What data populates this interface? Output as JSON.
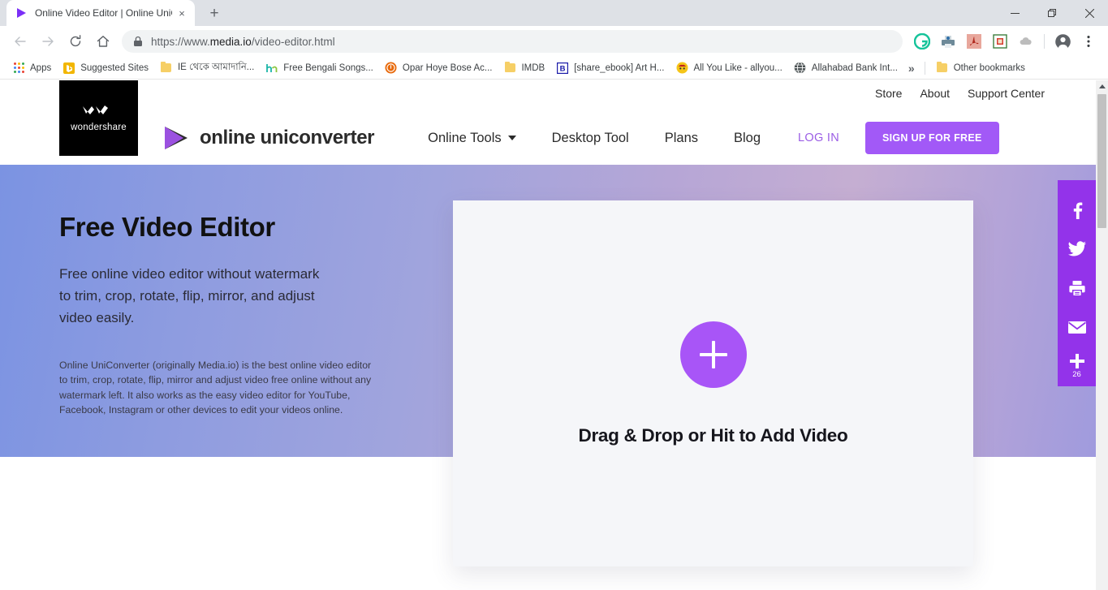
{
  "browser": {
    "tab": {
      "title": "Online Video Editor | Online UniC",
      "favicon_name": "play-triangle-favicon",
      "close_label": "×"
    },
    "new_tab_label": "+",
    "window_controls": {
      "minimize": "—",
      "maximize": "❐",
      "close": "✕"
    },
    "nav": {
      "back": "←",
      "forward": "→",
      "reload": "⟳",
      "home": "⌂"
    },
    "omnibox": {
      "scheme": "https://www.",
      "host": "media.io",
      "path": "/video-editor.html",
      "full_url": "https://www.media.io/video-editor.html",
      "lock_icon": "lock-icon"
    },
    "extensions": [
      {
        "name": "grammarly-extension-icon",
        "color": "#15c39a",
        "glyph": "G"
      },
      {
        "name": "printer-extension-icon",
        "color": "#8aa0ab",
        "glyph": ""
      },
      {
        "name": "adobe-acrobat-extension-icon",
        "color": "#d98c80",
        "glyph": ""
      },
      {
        "name": "red-box-extension-icon",
        "color": "#d64b3f",
        "glyph": ""
      },
      {
        "name": "cloud-extension-icon",
        "color": "#bcbcbc",
        "glyph": ""
      }
    ],
    "profile_icon": "account-avatar-icon",
    "menu_icon": "three-dot-menu-icon",
    "bookmarks": [
      {
        "label": "Apps",
        "icon": "apps-grid-icon"
      },
      {
        "label": "Suggested Sites",
        "icon": "bing-icon"
      },
      {
        "label": "IE থেকে আমাদানি...",
        "icon": "folder-icon"
      },
      {
        "label": "Free Bengali Songs...",
        "icon": "hungama-icon"
      },
      {
        "label": "Opar Hoye Bose Ac...",
        "icon": "orange-circle-icon"
      },
      {
        "label": "IMDB",
        "icon": "folder-icon"
      },
      {
        "label": "[share_ebook] Art H...",
        "icon": "b-letter-icon"
      },
      {
        "label": "All You Like - allyou...",
        "icon": "yellow-face-icon"
      },
      {
        "label": "Allahabad Bank  Int...",
        "icon": "globe-icon"
      }
    ],
    "bookmarks_overflow": "»",
    "other_bookmarks": {
      "label": "Other bookmarks",
      "icon": "folder-icon"
    }
  },
  "site": {
    "utility_links": [
      "Store",
      "About",
      "Support Center"
    ],
    "wondershare_logo": {
      "name": "wondershare",
      "mark": "wondershare-w-mark"
    },
    "brand": {
      "name": "online uniconverter",
      "logo_icon": "purple-play-triangle-icon"
    },
    "nav": [
      {
        "label": "Online Tools",
        "has_dropdown": true
      },
      {
        "label": "Desktop Tool",
        "has_dropdown": false
      },
      {
        "label": "Plans",
        "has_dropdown": false
      },
      {
        "label": "Blog",
        "has_dropdown": false
      }
    ],
    "login_label": "LOG IN",
    "signup_label": "SIGN UP FOR FREE",
    "accent_color": "#a259f7",
    "login_color": "#9b5de5"
  },
  "hero": {
    "heading": "Free Video Editor",
    "subheading": "Free online video editor without watermark to trim, crop, rotate, flip, mirror, and adjust video easily.",
    "description": "Online UniConverter (originally Media.io) is the best online video editor to trim, crop, rotate, flip, mirror and adjust video free online without any watermark left. It also works as the easy video editor for YouTube, Facebook, Instagram or other devices to edit your videos online.",
    "gradient_start": "#7b93e2",
    "gradient_end": "#9e9ade"
  },
  "dropzone": {
    "add_button_icon": "plus-icon",
    "add_button_color": "#a855f7",
    "label": "Drag & Drop or Hit to Add Video",
    "background": "#f5f6f9"
  },
  "share_rail": {
    "background": "#9333ea",
    "items": [
      {
        "name": "facebook-share-icon",
        "label": "f"
      },
      {
        "name": "twitter-share-icon",
        "label": ""
      },
      {
        "name": "print-share-icon",
        "label": ""
      },
      {
        "name": "email-share-icon",
        "label": ""
      },
      {
        "name": "more-share-icon",
        "label": "+"
      }
    ],
    "count": "26"
  },
  "scrollbar": {
    "up_arrow": "▲"
  }
}
